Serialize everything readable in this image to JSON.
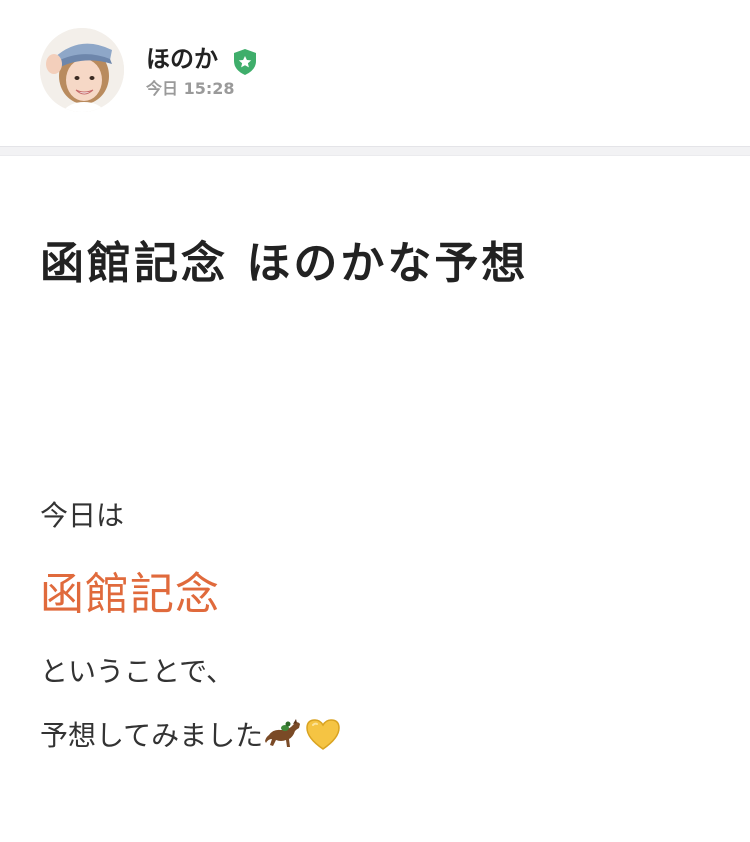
{
  "post_header": {
    "author_name": "ほのか",
    "timestamp": "今日 15:28",
    "avatar_icon": "avatar-photo",
    "badge_icon": "verified-shield-star-icon",
    "badge_color": "#3fae6b"
  },
  "article": {
    "title": "函館記念 ほのかな予想",
    "line1": "今日は",
    "highlight": "函館記念",
    "highlight_color": "#e06a3c",
    "line2": "ということで、",
    "line3": "予想してみました",
    "emojis": [
      "horse-racing-emoji",
      "yellow-heart-emoji"
    ]
  }
}
